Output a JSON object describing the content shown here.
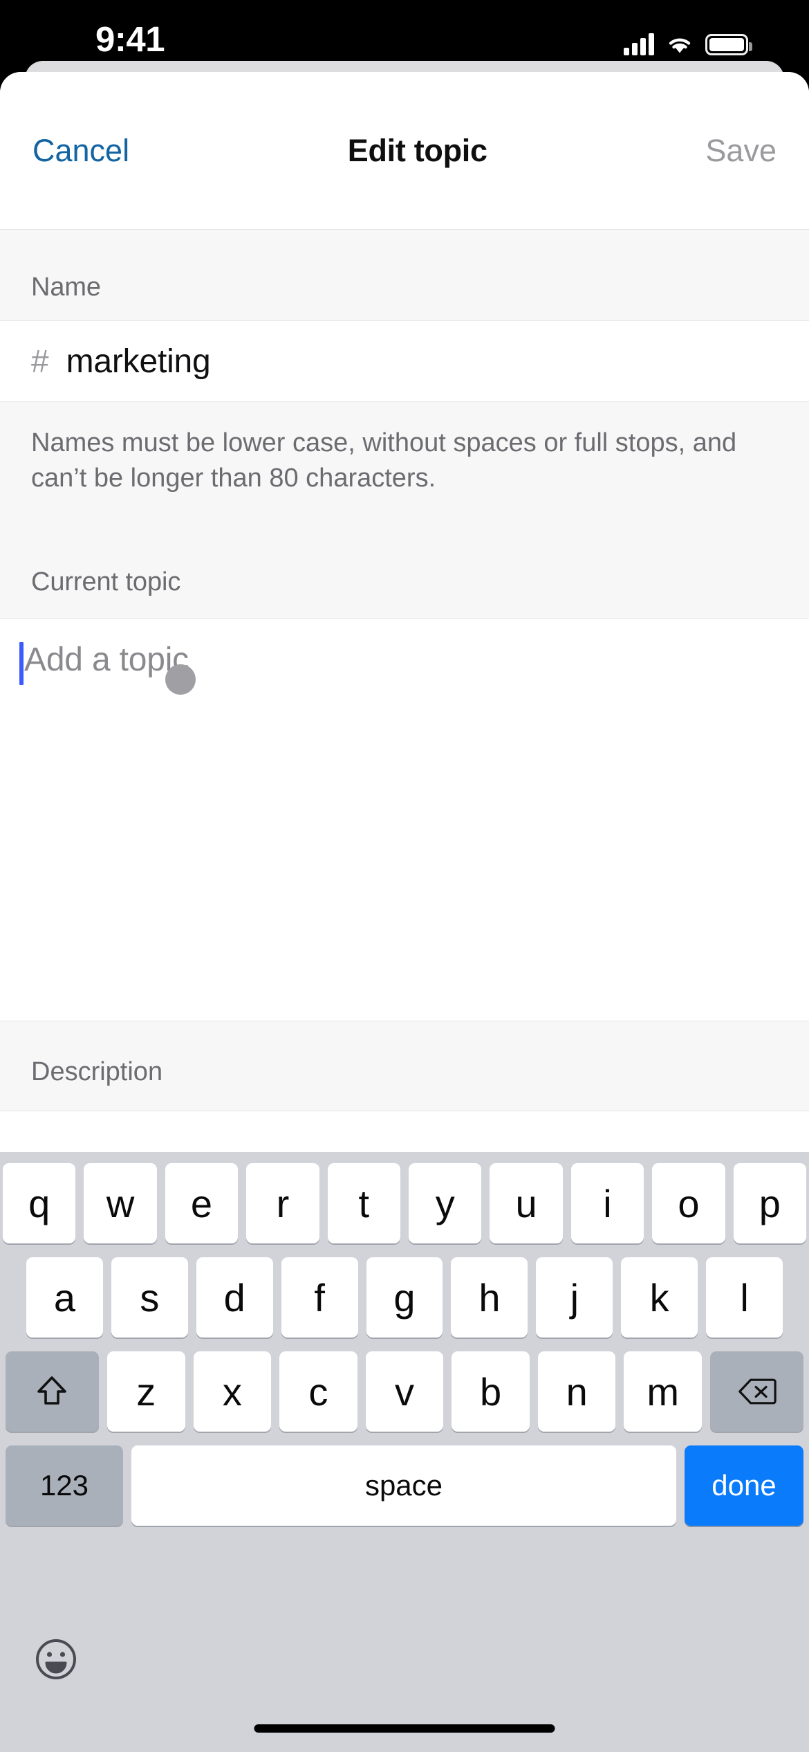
{
  "status_bar": {
    "time": "9:41",
    "icons": [
      "cellular-signal-icon",
      "wifi-icon",
      "battery-icon"
    ]
  },
  "nav": {
    "cancel_label": "Cancel",
    "title": "Edit topic",
    "save_label": "Save",
    "cancel_color": "#1264a3",
    "save_color": "#9b9b9f"
  },
  "form": {
    "name_section_label": "Name",
    "name_prefix": "#",
    "name_value": "marketing",
    "name_helper": "Names must be lower case, without spaces or full stops, and can’t be longer than 80 characters.",
    "topic_section_label": "Current topic",
    "topic_placeholder": "Add a topic",
    "topic_value": "",
    "description_section_label": "Description",
    "caret_color": "#3b5bfd"
  },
  "keyboard": {
    "row1": [
      "q",
      "w",
      "e",
      "r",
      "t",
      "y",
      "u",
      "i",
      "o",
      "p"
    ],
    "row2": [
      "a",
      "s",
      "d",
      "f",
      "g",
      "h",
      "j",
      "k",
      "l"
    ],
    "row3": [
      "z",
      "x",
      "c",
      "v",
      "b",
      "n",
      "m"
    ],
    "shift_icon": "shift-arrow-icon",
    "backspace_icon": "backspace-delete-icon",
    "numbers_label": "123",
    "space_label": "space",
    "return_label": "done",
    "return_color": "#0a7bfb",
    "emoji_icon": "emoji-smiley-icon"
  },
  "system": {
    "home_indicator": "home-indicator"
  }
}
